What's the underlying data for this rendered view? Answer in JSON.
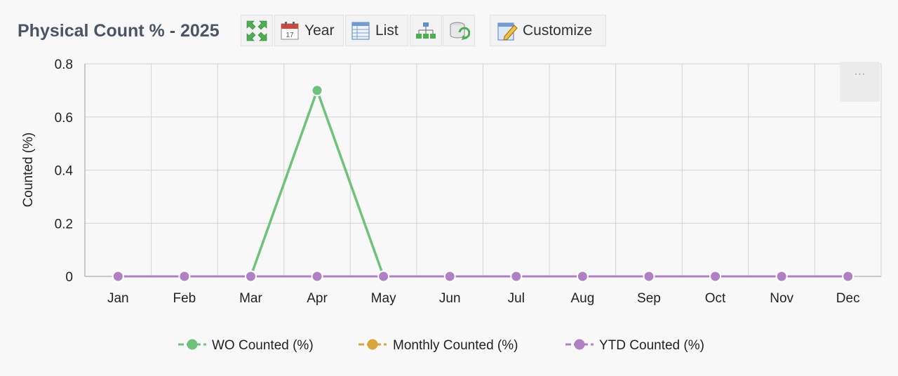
{
  "header": {
    "title": "Physical Count % - 2025",
    "toolbar": {
      "expand_icon": "expand-arrows-icon",
      "year_label": "Year",
      "year_icon": "calendar-icon",
      "list_label": "List",
      "list_icon": "list-table-icon",
      "hierarchy_icon": "hierarchy-icon",
      "refresh_icon": "database-refresh-icon",
      "customize_label": "Customize",
      "customize_icon": "edit-pencil-icon"
    }
  },
  "chart_menu": {
    "label": "···",
    "icon": "more-dots-icon"
  },
  "chart_data": {
    "type": "line",
    "title": "",
    "xlabel": "",
    "ylabel": "Counted (%)",
    "categories": [
      "Jan",
      "Feb",
      "Mar",
      "Apr",
      "May",
      "Jun",
      "Jul",
      "Aug",
      "Sep",
      "Oct",
      "Nov",
      "Dec"
    ],
    "ylim": [
      0,
      0.8
    ],
    "yticks": [
      "0",
      "0.2",
      "0.4",
      "0.6",
      "0.8"
    ],
    "ytick_values": [
      0,
      0.2,
      0.4,
      0.6,
      0.8
    ],
    "grid": true,
    "legend_position": "bottom",
    "series": [
      {
        "name": "WO Counted (%)",
        "color": "#70c17a",
        "values": [
          null,
          null,
          0,
          0.7,
          0,
          null,
          null,
          null,
          null,
          null,
          null,
          null
        ],
        "show_markers": "Apr"
      },
      {
        "name": "Monthly Counted (%)",
        "color": "#dba53a",
        "values": [
          0,
          0,
          0,
          0,
          0,
          0,
          0,
          0,
          0,
          0,
          0,
          0
        ]
      },
      {
        "name": "YTD Counted (%)",
        "color": "#b17fc4",
        "values": [
          0,
          0,
          0,
          0,
          0,
          0,
          0,
          0,
          0,
          0,
          0,
          0
        ]
      }
    ]
  }
}
